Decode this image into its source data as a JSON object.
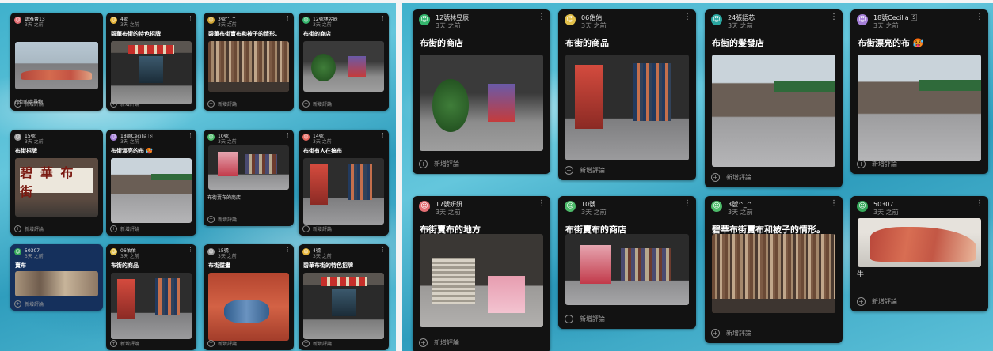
{
  "comment_label": "新增評論",
  "left_panel": {
    "cards": [
      {
        "avatar_color": "#e46f74",
        "avatar_letter": "",
        "name": "鄭雅菁13",
        "time": "3天 之前",
        "title": "",
        "caption": "布街的走尋物",
        "scene": "road"
      },
      {
        "avatar_color": "#e7b53a",
        "avatar_letter": "",
        "name": "4號",
        "time": "3天 之前",
        "title": "碧華布街的特色招牌",
        "caption": "",
        "scene": "shopfront"
      },
      {
        "avatar_color": "#d2a735",
        "avatar_letter": "",
        "name": "3號^_^",
        "time": "3天 之前",
        "title": "碧華布街賣布和被子的情形。",
        "caption": "",
        "scene": "fabric"
      },
      {
        "avatar_color": "#34b56c",
        "avatar_letter": "",
        "name": "12號林昱辰",
        "time": "3天 之前",
        "title": "布街的商店",
        "caption": "",
        "scene": "plants"
      },
      {
        "avatar_color": "#9a9a9a",
        "avatar_letter": "",
        "name": "15號",
        "time": "3天 之前",
        "title": "布街招牌",
        "caption": "",
        "scene": "sign"
      },
      {
        "avatar_color": "#a57fd8",
        "avatar_letter": "",
        "name": "18號Cecilia 🅂",
        "time": "3天 之前",
        "title": "布街漂亮的布 🥵",
        "caption": "",
        "scene": "street"
      },
      {
        "avatar_color": "#4dbb6a",
        "avatar_letter": "",
        "name": "10號",
        "time": "3天 之前",
        "title": "",
        "caption": "布街賣布的商店",
        "scene": "shop2"
      },
      {
        "avatar_color": "#e7675e",
        "avatar_letter": "",
        "name": "14號",
        "time": "3天 之前",
        "title": "布街有人在搞布",
        "caption": "",
        "scene": "rack"
      },
      {
        "avatar_color": "#35a85a",
        "avatar_letter": "",
        "name": "50307",
        "time": "3天 之前",
        "title": "賣布",
        "caption": "",
        "scene": "blue"
      },
      {
        "avatar_color": "#e3c04a",
        "avatar_letter": "",
        "name": "06佑佑",
        "time": "3天 之前",
        "title": "布街的商品",
        "caption": "",
        "scene": "rack"
      },
      {
        "avatar_color": "#9a9a9a",
        "avatar_letter": "",
        "name": "15號",
        "time": "3天 之前",
        "title": "布街壁畫",
        "caption": "",
        "scene": "wall"
      },
      {
        "avatar_color": "#e7b53a",
        "avatar_letter": "",
        "name": "4號",
        "time": "3天 之前",
        "title": "碧華布街的特色招牌",
        "caption": "",
        "scene": "shopfront"
      }
    ]
  },
  "right_panel": {
    "cards": [
      {
        "avatar_color": "#34b56c",
        "avatar_letter": "",
        "name": "12號林昱辰",
        "time": "3天 之前",
        "title": "布街的商店",
        "caption": "",
        "scene": "plants"
      },
      {
        "avatar_color": "#e3c04a",
        "avatar_letter": "",
        "name": "06佑佑",
        "time": "3天 之前",
        "title": "布街的商品",
        "caption": "",
        "scene": "rack"
      },
      {
        "avatar_color": "#2aa6a0",
        "avatar_letter": "",
        "name": "24張語芯",
        "time": "3天 之前",
        "title": "布街的髮發店",
        "caption": "",
        "scene": "street"
      },
      {
        "avatar_color": "#a57fd8",
        "avatar_letter": "",
        "name": "18號Cecilia 🅂",
        "time": "3天 之前",
        "title": "布街漂亮的布 🥵",
        "caption": "",
        "scene": "street"
      },
      {
        "avatar_color": "#e46f74",
        "avatar_letter": "",
        "name": "17號妍妍",
        "time": "3天 之前",
        "title": "布街賣布的地方",
        "caption": "",
        "scene": "pile"
      },
      {
        "avatar_color": "#4dbb6a",
        "avatar_letter": "",
        "name": "10號",
        "time": "3天 之前",
        "title": "布街賣布的商店",
        "caption": "",
        "scene": "shop2"
      },
      {
        "avatar_color": "#4dbb6a",
        "avatar_letter": "",
        "name": "3號^_^",
        "time": "3天 之前",
        "title": "碧華布街賣布和被子的情形。",
        "caption": "",
        "scene": "fabric"
      },
      {
        "avatar_color": "#35a85a",
        "avatar_letter": "",
        "name": "50307",
        "time": "3天 之前",
        "title": "",
        "caption": "牛",
        "scene": "mural"
      }
    ]
  }
}
